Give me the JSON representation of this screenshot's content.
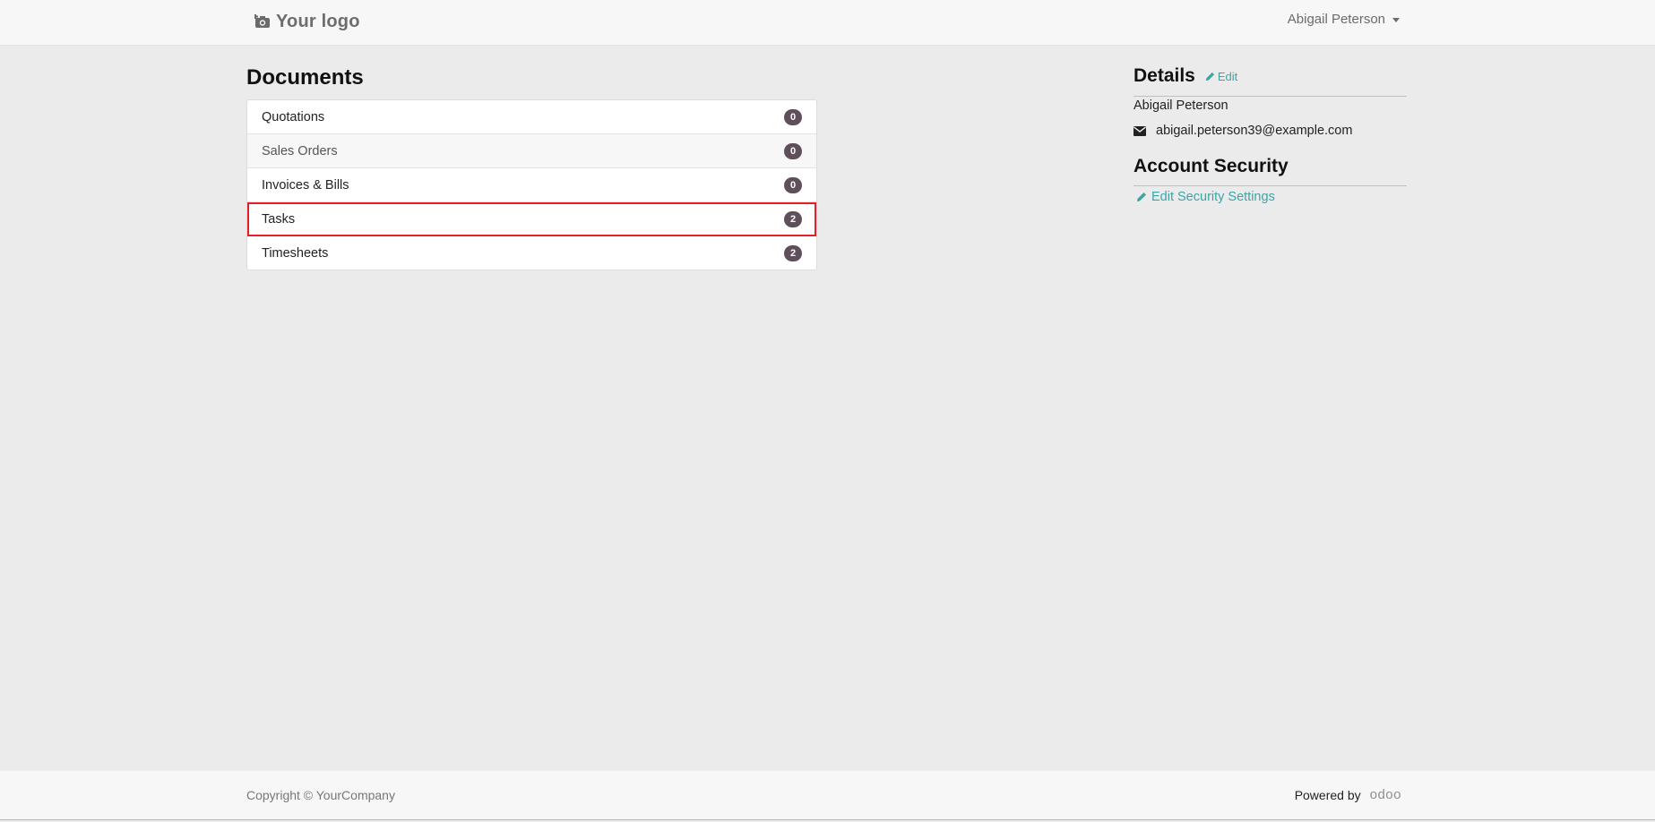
{
  "header": {
    "logo_text": "Your logo",
    "user_name": "Abigail Peterson"
  },
  "documents": {
    "title": "Documents",
    "items": [
      {
        "label": "Quotations",
        "count": "0"
      },
      {
        "label": "Sales Orders",
        "count": "0"
      },
      {
        "label": "Invoices & Bills",
        "count": "0"
      },
      {
        "label": "Tasks",
        "count": "2"
      },
      {
        "label": "Timesheets",
        "count": "2"
      }
    ]
  },
  "details": {
    "title": "Details",
    "edit_label": "Edit",
    "name": "Abigail Peterson",
    "email": "abigail.peterson39@example.com"
  },
  "security": {
    "title": "Account Security",
    "link_label": "Edit Security Settings"
  },
  "footer": {
    "copyright": "Copyright © YourCompany",
    "powered_by": "Powered by",
    "brand": "odoo"
  },
  "colors": {
    "accent": "#3aa5a7",
    "badge": "#5e4f5b",
    "highlight": "#e2202a"
  },
  "icons": {
    "logo": "camera-icon",
    "edit": "pencil-icon",
    "email": "envelope-icon"
  }
}
